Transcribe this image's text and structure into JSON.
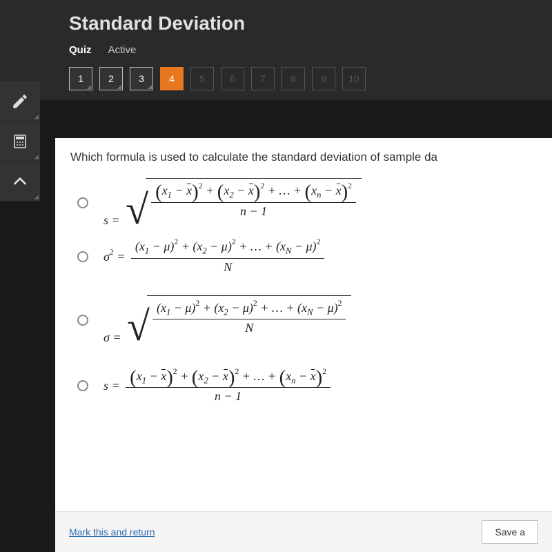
{
  "header": {
    "title": "Standard Deviation",
    "tabs": {
      "quiz": "Quiz",
      "active": "Active"
    }
  },
  "questionNumbers": [
    "1",
    "2",
    "3",
    "4",
    "5",
    "6",
    "7",
    "8",
    "9",
    "10"
  ],
  "currentQuestion": 4,
  "completedUpTo": 3,
  "question": "Which formula is used to calculate the standard deviation of sample da",
  "answers": {
    "a": {
      "lhs": "s =",
      "num_tex": "(x₁−x̄)² + (x₂−x̄)² + … + (xₙ−x̄)²",
      "den": "n − 1",
      "sqrt": true
    },
    "b": {
      "lhs": "σ² =",
      "num_tex": "(x₁−μ)² + (x₂−μ)² + … + (x_N−μ)²",
      "den": "N",
      "sqrt": false
    },
    "c": {
      "lhs": "σ =",
      "num_tex": "(x₁−μ)² + (x₂−μ)² + … + (x_N−μ)²",
      "den": "N",
      "sqrt": true
    },
    "d": {
      "lhs": "s =",
      "num_tex": "(x₁−x̄)² + (x₂−x̄)² + … + (xₙ−x̄)²",
      "den": "n − 1",
      "sqrt": false
    }
  },
  "footer": {
    "mark": "Mark this and return",
    "save": "Save a"
  }
}
